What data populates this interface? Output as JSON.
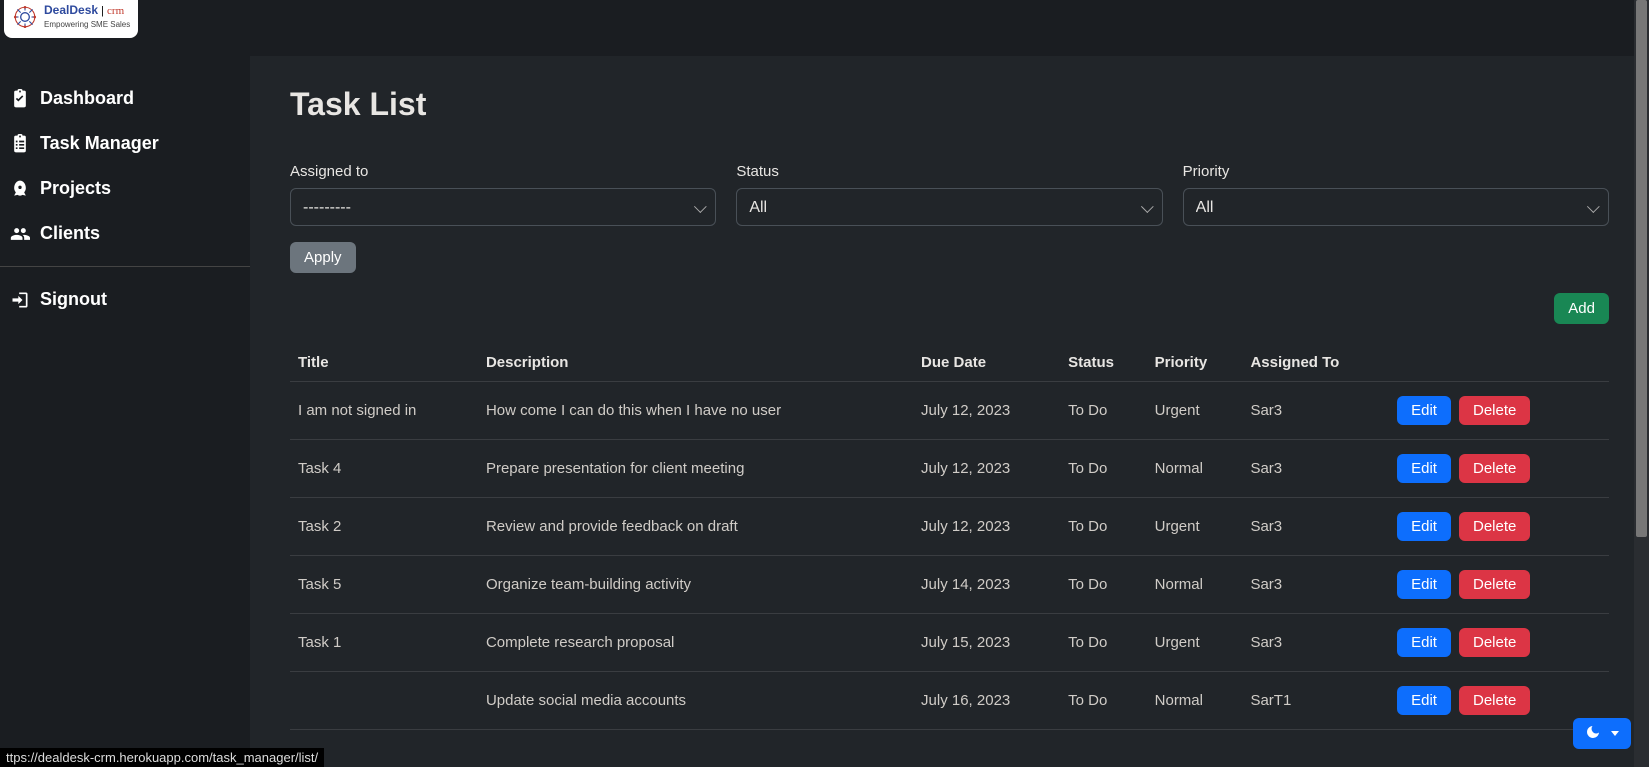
{
  "app": {
    "logo_main": "DealDesk",
    "logo_sep": " | ",
    "logo_script": "crm",
    "logo_sub": "Empowering SME Sales"
  },
  "nav": {
    "dashboard": "Dashboard",
    "task_manager": "Task Manager",
    "projects": "Projects",
    "clients": "Clients",
    "signout": "Signout"
  },
  "page": {
    "title": "Task List"
  },
  "filters": {
    "assigned_to_label": "Assigned to",
    "assigned_to_value": "---------",
    "status_label": "Status",
    "status_value": "All",
    "priority_label": "Priority",
    "priority_value": "All",
    "apply_label": "Apply"
  },
  "buttons": {
    "add": "Add",
    "edit": "Edit",
    "delete": "Delete"
  },
  "table": {
    "headers": {
      "title": "Title",
      "description": "Description",
      "due_date": "Due Date",
      "status": "Status",
      "priority": "Priority",
      "assigned_to": "Assigned To"
    },
    "rows": [
      {
        "title": "I am not signed in",
        "description": "How come I can do this when I have no user",
        "due_date": "July 12, 2023",
        "status": "To Do",
        "priority": "Urgent",
        "assigned_to": "Sar3"
      },
      {
        "title": "Task 4",
        "description": "Prepare presentation for client meeting",
        "due_date": "July 12, 2023",
        "status": "To Do",
        "priority": "Normal",
        "assigned_to": "Sar3"
      },
      {
        "title": "Task 2",
        "description": "Review and provide feedback on draft",
        "due_date": "July 12, 2023",
        "status": "To Do",
        "priority": "Urgent",
        "assigned_to": "Sar3"
      },
      {
        "title": "Task 5",
        "description": "Organize team-building activity",
        "due_date": "July 14, 2023",
        "status": "To Do",
        "priority": "Normal",
        "assigned_to": "Sar3"
      },
      {
        "title": "Task 1",
        "description": "Complete research proposal",
        "due_date": "July 15, 2023",
        "status": "To Do",
        "priority": "Urgent",
        "assigned_to": "Sar3"
      },
      {
        "title": "",
        "description": "Update social media accounts",
        "due_date": "July 16, 2023",
        "status": "To Do",
        "priority": "Normal",
        "assigned_to": "SarT1"
      }
    ]
  },
  "status_url": "ttps://dealdesk-crm.herokuapp.com/task_manager/list/"
}
